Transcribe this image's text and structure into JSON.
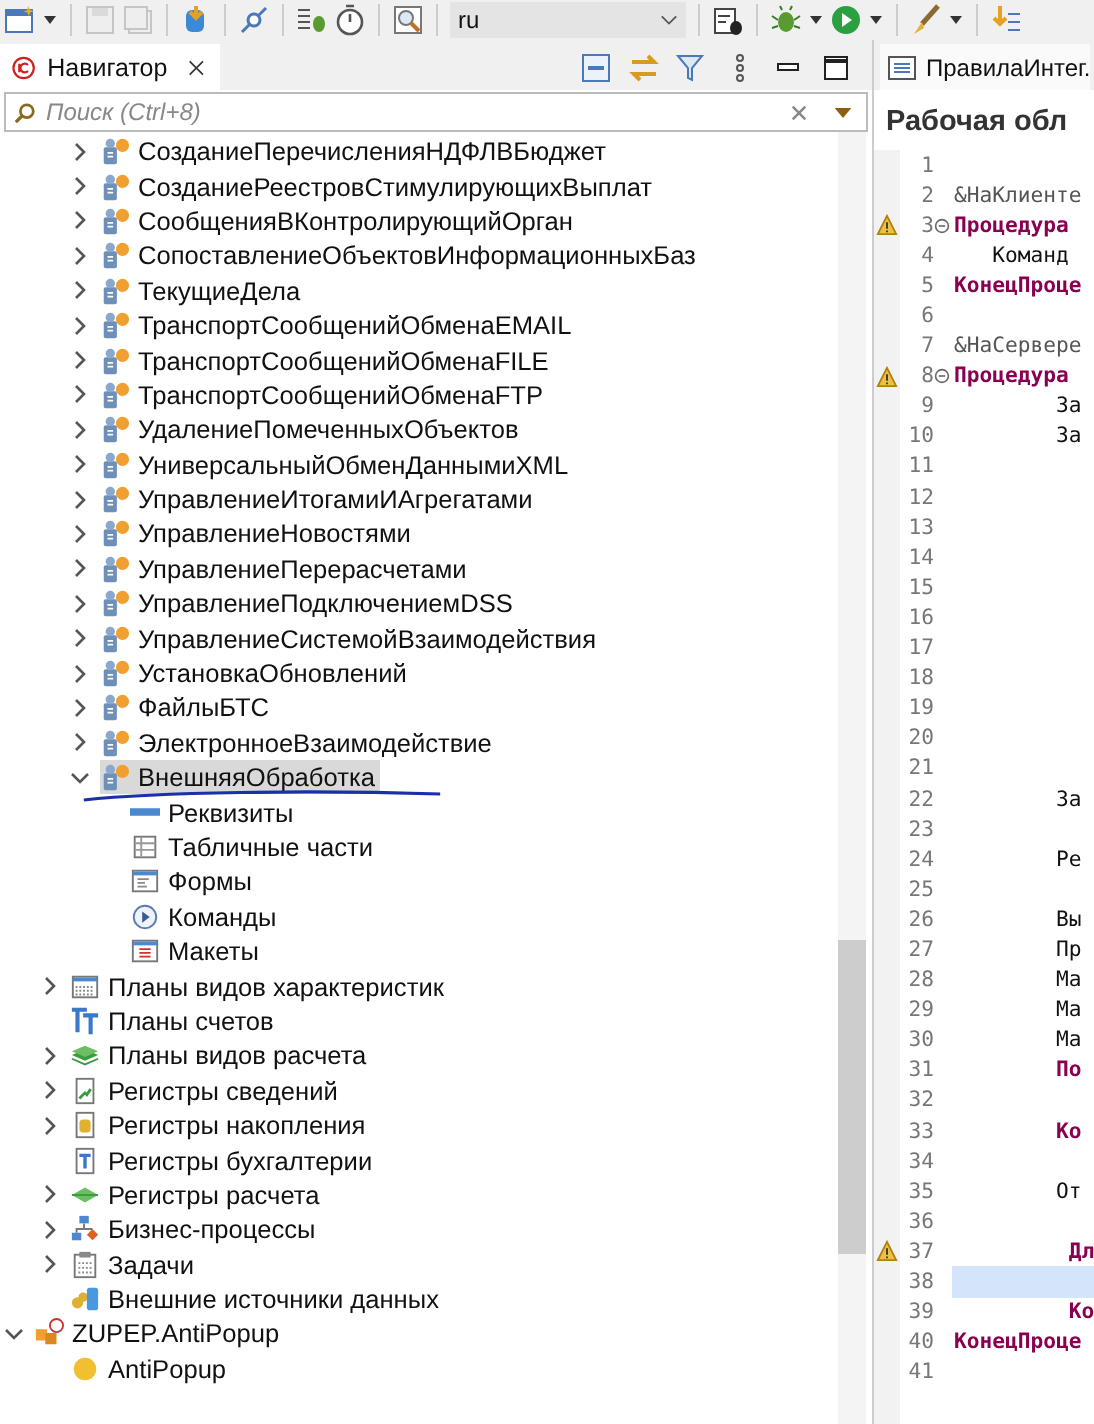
{
  "toolbar": {
    "language": "ru"
  },
  "navigator": {
    "title": "Навигатор",
    "search": {
      "placeholder": "Поиск (Ctrl+8)"
    },
    "processors": [
      {
        "label": "СозданиеПеречисленияНДФЛВБюджет",
        "kind": "processor",
        "expanded": false,
        "selected": false
      },
      {
        "label": "СозданиеРеестровСтимулирующихВыплат",
        "kind": "processor",
        "expanded": false,
        "selected": false
      },
      {
        "label": "СообщенияВКонтролирующийОрган",
        "kind": "processor",
        "expanded": false,
        "selected": false
      },
      {
        "label": "СопоставлениеОбъектовИнформационныхБаз",
        "kind": "processor",
        "expanded": false,
        "selected": false
      },
      {
        "label": "ТекущиеДела",
        "kind": "processor",
        "expanded": false,
        "selected": false
      },
      {
        "label": "ТранспортСообщенийОбменаEMAIL",
        "kind": "processor",
        "expanded": false,
        "selected": false
      },
      {
        "label": "ТранспортСообщенийОбменаFILE",
        "kind": "processor",
        "expanded": false,
        "selected": false
      },
      {
        "label": "ТранспортСообщенийОбменаFTP",
        "kind": "processor",
        "expanded": false,
        "selected": false
      },
      {
        "label": "УдалениеПомеченныхОбъектов",
        "kind": "processor",
        "expanded": false,
        "selected": false
      },
      {
        "label": "УниверсальныйОбменДаннымиXML",
        "kind": "processor",
        "expanded": false,
        "selected": false
      },
      {
        "label": "УправлениеИтогамиИАгрегатами",
        "kind": "processor",
        "expanded": false,
        "selected": false
      },
      {
        "label": "УправлениеНовостями",
        "kind": "processor",
        "expanded": false,
        "selected": false
      },
      {
        "label": "УправлениеПерерасчетами",
        "kind": "processor",
        "expanded": false,
        "selected": false
      },
      {
        "label": "УправлениеПодключениемDSS",
        "kind": "processor",
        "expanded": false,
        "selected": false
      },
      {
        "label": "УправлениеСистемойВзаимодействия",
        "kind": "processor",
        "expanded": false,
        "selected": false
      },
      {
        "label": "УстановкаОбновлений",
        "kind": "processor",
        "expanded": false,
        "selected": false
      },
      {
        "label": "ФайлыБТС",
        "kind": "processor",
        "expanded": false,
        "selected": false
      },
      {
        "label": "ЭлектронноеВзаимодействие",
        "kind": "processor",
        "expanded": false,
        "selected": false
      },
      {
        "label": "ВнешняяОбработка",
        "kind": "processor",
        "expanded": true,
        "selected": true,
        "annotated": true,
        "children": [
          {
            "label": "Реквизиты",
            "kind": "attributes",
            "selected": false
          },
          {
            "label": "Табличные части",
            "kind": "tabular",
            "selected": false
          },
          {
            "label": "Формы",
            "kind": "forms",
            "selected": false
          },
          {
            "label": "Команды",
            "kind": "commands",
            "selected": false
          },
          {
            "label": "Макеты",
            "kind": "templates",
            "selected": false
          }
        ]
      }
    ],
    "metadata": [
      {
        "label": "Планы видов характеристик",
        "kind": "char-plan",
        "expanded": false,
        "selected": false
      },
      {
        "label": "Планы счетов",
        "kind": "accounts",
        "selected": false
      },
      {
        "label": "Планы видов расчета",
        "kind": "calc-plan",
        "expanded": false,
        "selected": false
      },
      {
        "label": "Регистры сведений",
        "kind": "info-register",
        "expanded": false,
        "selected": false
      },
      {
        "label": "Регистры накопления",
        "kind": "accum-register",
        "expanded": false,
        "selected": false
      },
      {
        "label": "Регистры бухгалтерии",
        "kind": "accounting-register",
        "selected": false
      },
      {
        "label": "Регистры расчета",
        "kind": "calc-register",
        "expanded": false,
        "selected": false
      },
      {
        "label": "Бизнес-процессы",
        "kind": "business-process",
        "expanded": false,
        "selected": false
      },
      {
        "label": "Задачи",
        "kind": "task",
        "expanded": false,
        "selected": false
      },
      {
        "label": "Внешние источники данных",
        "kind": "external-source",
        "selected": false
      }
    ],
    "extensions": [
      {
        "label": "ZUPEP.AntiPopup",
        "kind": "config",
        "expanded": true,
        "selected": false,
        "children": [
          {
            "label": "AntiPopup",
            "kind": "module",
            "selected": false
          }
        ]
      }
    ]
  },
  "editor": {
    "tab": "ПравилаИнтег.",
    "heading": "Рабочая обл",
    "lines": [
      {
        "number": "1",
        "warning": false,
        "fold": false,
        "current": false
      },
      {
        "number": "2",
        "text": "&НаКлиенте",
        "kind": "directive",
        "warning": false,
        "fold": false,
        "current": false
      },
      {
        "number": "3",
        "text": "Процедура",
        "kind": "keyword",
        "warning": true,
        "fold": true,
        "current": false
      },
      {
        "number": "4",
        "text": "   Команд",
        "kind": "plain",
        "warning": false,
        "fold": false,
        "current": false
      },
      {
        "number": "5",
        "text": "КонецПроце",
        "kind": "keyword",
        "warning": false,
        "fold": false,
        "current": false
      },
      {
        "number": "6",
        "warning": false,
        "fold": false,
        "current": false
      },
      {
        "number": "7",
        "text": "&НаСервере",
        "kind": "directive",
        "warning": false,
        "fold": false,
        "current": false
      },
      {
        "number": "8",
        "text": "Процедура",
        "kind": "keyword",
        "warning": true,
        "fold": true,
        "current": false
      },
      {
        "number": "9",
        "text": "        За",
        "kind": "plain",
        "warning": false,
        "fold": false,
        "current": false
      },
      {
        "number": "10",
        "text": "        За",
        "kind": "plain",
        "warning": false,
        "fold": false,
        "current": false
      },
      {
        "number": "11",
        "warning": false,
        "fold": false,
        "current": false
      },
      {
        "number": "12",
        "warning": false,
        "fold": false,
        "current": false
      },
      {
        "number": "13",
        "warning": false,
        "fold": false,
        "current": false
      },
      {
        "number": "14",
        "warning": false,
        "fold": false,
        "current": false
      },
      {
        "number": "15",
        "warning": false,
        "fold": false,
        "current": false
      },
      {
        "number": "16",
        "warning": false,
        "fold": false,
        "current": false
      },
      {
        "number": "17",
        "warning": false,
        "fold": false,
        "current": false
      },
      {
        "number": "18",
        "warning": false,
        "fold": false,
        "current": false
      },
      {
        "number": "19",
        "warning": false,
        "fold": false,
        "current": false
      },
      {
        "number": "20",
        "warning": false,
        "fold": false,
        "current": false
      },
      {
        "number": "21",
        "warning": false,
        "fold": false,
        "current": false
      },
      {
        "number": "22",
        "text": "        За",
        "kind": "plain",
        "warning": false,
        "fold": false,
        "current": false
      },
      {
        "number": "23",
        "warning": false,
        "fold": false,
        "current": false
      },
      {
        "number": "24",
        "text": "        Ре",
        "kind": "plain",
        "warning": false,
        "fold": false,
        "current": false
      },
      {
        "number": "25",
        "warning": false,
        "fold": false,
        "current": false
      },
      {
        "number": "26",
        "text": "        Вы",
        "kind": "plain",
        "warning": false,
        "fold": false,
        "current": false
      },
      {
        "number": "27",
        "text": "        Пр",
        "kind": "plain",
        "warning": false,
        "fold": false,
        "current": false
      },
      {
        "number": "28",
        "text": "        Ма",
        "kind": "plain",
        "warning": false,
        "fold": false,
        "current": false
      },
      {
        "number": "29",
        "text": "        Ма",
        "kind": "plain",
        "warning": false,
        "fold": false,
        "current": false
      },
      {
        "number": "30",
        "text": "        Ма",
        "kind": "plain",
        "warning": false,
        "fold": false,
        "current": false
      },
      {
        "number": "31",
        "text": "        По",
        "kind": "keyword",
        "warning": false,
        "fold": false,
        "current": false
      },
      {
        "number": "32",
        "warning": false,
        "fold": false,
        "current": false
      },
      {
        "number": "33",
        "text": "        Ко",
        "kind": "keyword",
        "warning": false,
        "fold": false,
        "current": false
      },
      {
        "number": "34",
        "warning": false,
        "fold": false,
        "current": false
      },
      {
        "number": "35",
        "text": "        От",
        "kind": "plain",
        "warning": false,
        "fold": false,
        "current": false
      },
      {
        "number": "36",
        "warning": false,
        "fold": false,
        "current": false
      },
      {
        "number": "37",
        "text": "         Дл",
        "kind": "keyword",
        "warning": true,
        "fold": false,
        "current": false
      },
      {
        "number": "38",
        "warning": false,
        "fold": false,
        "current": true
      },
      {
        "number": "39",
        "text": "         Ко",
        "kind": "keyword",
        "warning": false,
        "fold": false,
        "current": false
      },
      {
        "number": "40",
        "text": "КонецПроце",
        "kind": "keyword",
        "warning": false,
        "fold": false,
        "current": false
      },
      {
        "number": "41",
        "warning": false,
        "fold": false,
        "current": false
      }
    ]
  }
}
